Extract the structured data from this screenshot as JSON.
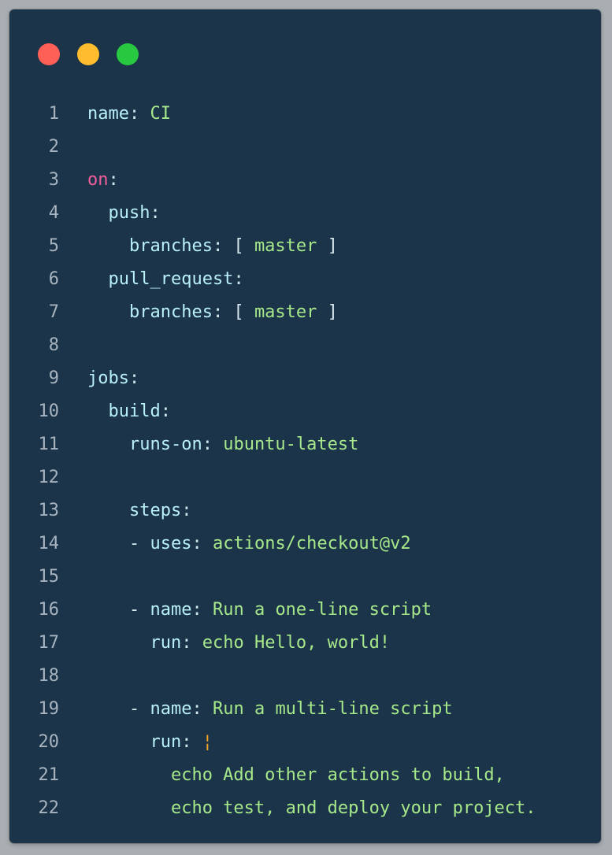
{
  "window": {
    "background": "#1b3449",
    "controls": [
      {
        "name": "close",
        "color": "#fe5f57"
      },
      {
        "name": "minimize",
        "color": "#febc2e"
      },
      {
        "name": "maximize",
        "color": "#28c840"
      }
    ]
  },
  "colors": {
    "key": "#b9f0f8",
    "punct": "#d6e6ee",
    "value": "#a6e88a",
    "keyword": "#f25e9b",
    "block": "#f5a623",
    "line_number": "#a7b4bf"
  },
  "lines": [
    {
      "n": "1",
      "tokens": [
        {
          "t": "name",
          "c": "key"
        },
        {
          "t": ": ",
          "c": "punct"
        },
        {
          "t": "CI",
          "c": "value"
        }
      ]
    },
    {
      "n": "2",
      "tokens": []
    },
    {
      "n": "3",
      "tokens": [
        {
          "t": "on",
          "c": "keyword"
        },
        {
          "t": ":",
          "c": "punct"
        }
      ]
    },
    {
      "n": "4",
      "tokens": [
        {
          "t": "  push",
          "c": "key"
        },
        {
          "t": ":",
          "c": "punct"
        }
      ]
    },
    {
      "n": "5",
      "tokens": [
        {
          "t": "    branches",
          "c": "key"
        },
        {
          "t": ": [ ",
          "c": "punct"
        },
        {
          "t": "master",
          "c": "value"
        },
        {
          "t": " ]",
          "c": "punct"
        }
      ]
    },
    {
      "n": "6",
      "tokens": [
        {
          "t": "  pull_request",
          "c": "key"
        },
        {
          "t": ":",
          "c": "punct"
        }
      ]
    },
    {
      "n": "7",
      "tokens": [
        {
          "t": "    branches",
          "c": "key"
        },
        {
          "t": ": [ ",
          "c": "punct"
        },
        {
          "t": "master",
          "c": "value"
        },
        {
          "t": " ]",
          "c": "punct"
        }
      ]
    },
    {
      "n": "8",
      "tokens": []
    },
    {
      "n": "9",
      "tokens": [
        {
          "t": "jobs",
          "c": "key"
        },
        {
          "t": ":",
          "c": "punct"
        }
      ]
    },
    {
      "n": "10",
      "tokens": [
        {
          "t": "  build",
          "c": "key"
        },
        {
          "t": ":",
          "c": "punct"
        }
      ]
    },
    {
      "n": "11",
      "tokens": [
        {
          "t": "    runs-on",
          "c": "key"
        },
        {
          "t": ": ",
          "c": "punct"
        },
        {
          "t": "ubuntu-latest",
          "c": "value"
        }
      ]
    },
    {
      "n": "12",
      "tokens": []
    },
    {
      "n": "13",
      "tokens": [
        {
          "t": "    steps",
          "c": "key"
        },
        {
          "t": ":",
          "c": "punct"
        }
      ]
    },
    {
      "n": "14",
      "tokens": [
        {
          "t": "    - ",
          "c": "punct"
        },
        {
          "t": "uses",
          "c": "key"
        },
        {
          "t": ": ",
          "c": "punct"
        },
        {
          "t": "actions/checkout@v2",
          "c": "value"
        }
      ]
    },
    {
      "n": "15",
      "tokens": []
    },
    {
      "n": "16",
      "tokens": [
        {
          "t": "    - ",
          "c": "punct"
        },
        {
          "t": "name",
          "c": "key"
        },
        {
          "t": ": ",
          "c": "punct"
        },
        {
          "t": "Run a one-line script",
          "c": "value"
        }
      ]
    },
    {
      "n": "17",
      "tokens": [
        {
          "t": "      run",
          "c": "key"
        },
        {
          "t": ": ",
          "c": "punct"
        },
        {
          "t": "echo Hello, world!",
          "c": "value"
        }
      ]
    },
    {
      "n": "18",
      "tokens": []
    },
    {
      "n": "19",
      "tokens": [
        {
          "t": "    - ",
          "c": "punct"
        },
        {
          "t": "name",
          "c": "key"
        },
        {
          "t": ": ",
          "c": "punct"
        },
        {
          "t": "Run a multi-line script",
          "c": "value"
        }
      ]
    },
    {
      "n": "20",
      "tokens": [
        {
          "t": "      run",
          "c": "key"
        },
        {
          "t": ": ",
          "c": "punct"
        },
        {
          "t": "¦",
          "c": "block"
        }
      ]
    },
    {
      "n": "21",
      "tokens": [
        {
          "t": "        echo Add other actions to build,",
          "c": "value"
        }
      ]
    },
    {
      "n": "22",
      "tokens": [
        {
          "t": "        echo test, and deploy your project.",
          "c": "value"
        }
      ]
    }
  ]
}
